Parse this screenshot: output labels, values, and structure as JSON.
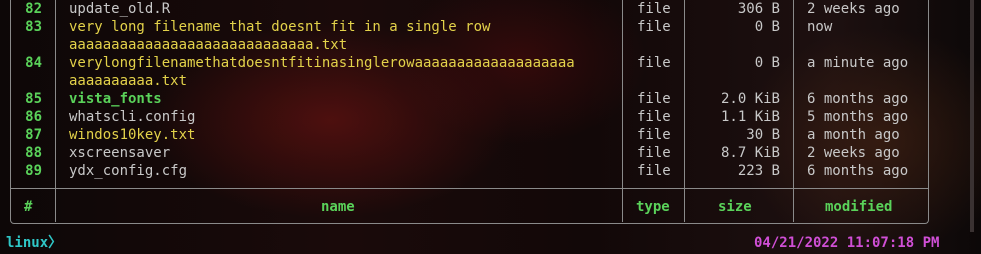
{
  "rows": [
    {
      "num": "82",
      "name": "update_old.R",
      "name_lines": 1,
      "style": "file",
      "type": "file",
      "size": "306 B",
      "modified": "2 weeks ago"
    },
    {
      "num": "83",
      "name": "very long filename that doesnt fit in a single row",
      "name2": "aaaaaaaaaaaaaaaaaaaaaaaaaaaaa.txt",
      "style": "yellow",
      "type": "file",
      "size": "0 B",
      "modified": "now"
    },
    {
      "num": "84",
      "name": "verylongfilenamethatdoesntfitinasinglerowaaaaaaaaaaaaaaaaaaa",
      "name2": "aaaaaaaaaa.txt",
      "style": "yellow",
      "type": "file",
      "size": "0 B",
      "modified": "a minute ago"
    },
    {
      "num": "85",
      "name": "vista_fonts",
      "style": "dir",
      "type": "file",
      "size": "2.0 KiB",
      "modified": "6 months ago"
    },
    {
      "num": "86",
      "name": "whatscli.config",
      "style": "file",
      "type": "file",
      "size": "1.1 KiB",
      "modified": "5 months ago"
    },
    {
      "num": "87",
      "name": "windos10key.txt",
      "style": "yellow",
      "type": "file",
      "size": "30 B",
      "modified": "a month ago"
    },
    {
      "num": "88",
      "name": "xscreensaver",
      "style": "file",
      "type": "file",
      "size": "8.7 KiB",
      "modified": "2 weeks ago"
    },
    {
      "num": "89",
      "name": "ydx_config.cfg",
      "style": "file",
      "type": "file",
      "size": "223 B",
      "modified": "6 months ago"
    }
  ],
  "header": {
    "num": "#",
    "name": "name",
    "type": "type",
    "size": "size",
    "modified": "modified"
  },
  "prompt": "linux〉",
  "clock": "04/21/2022 11:07:18 PM",
  "colors": {
    "accent_green": "#5ad25a",
    "yellow": "#e3d24a",
    "prompt": "#2fc7c7",
    "clock": "#d04fd6"
  }
}
